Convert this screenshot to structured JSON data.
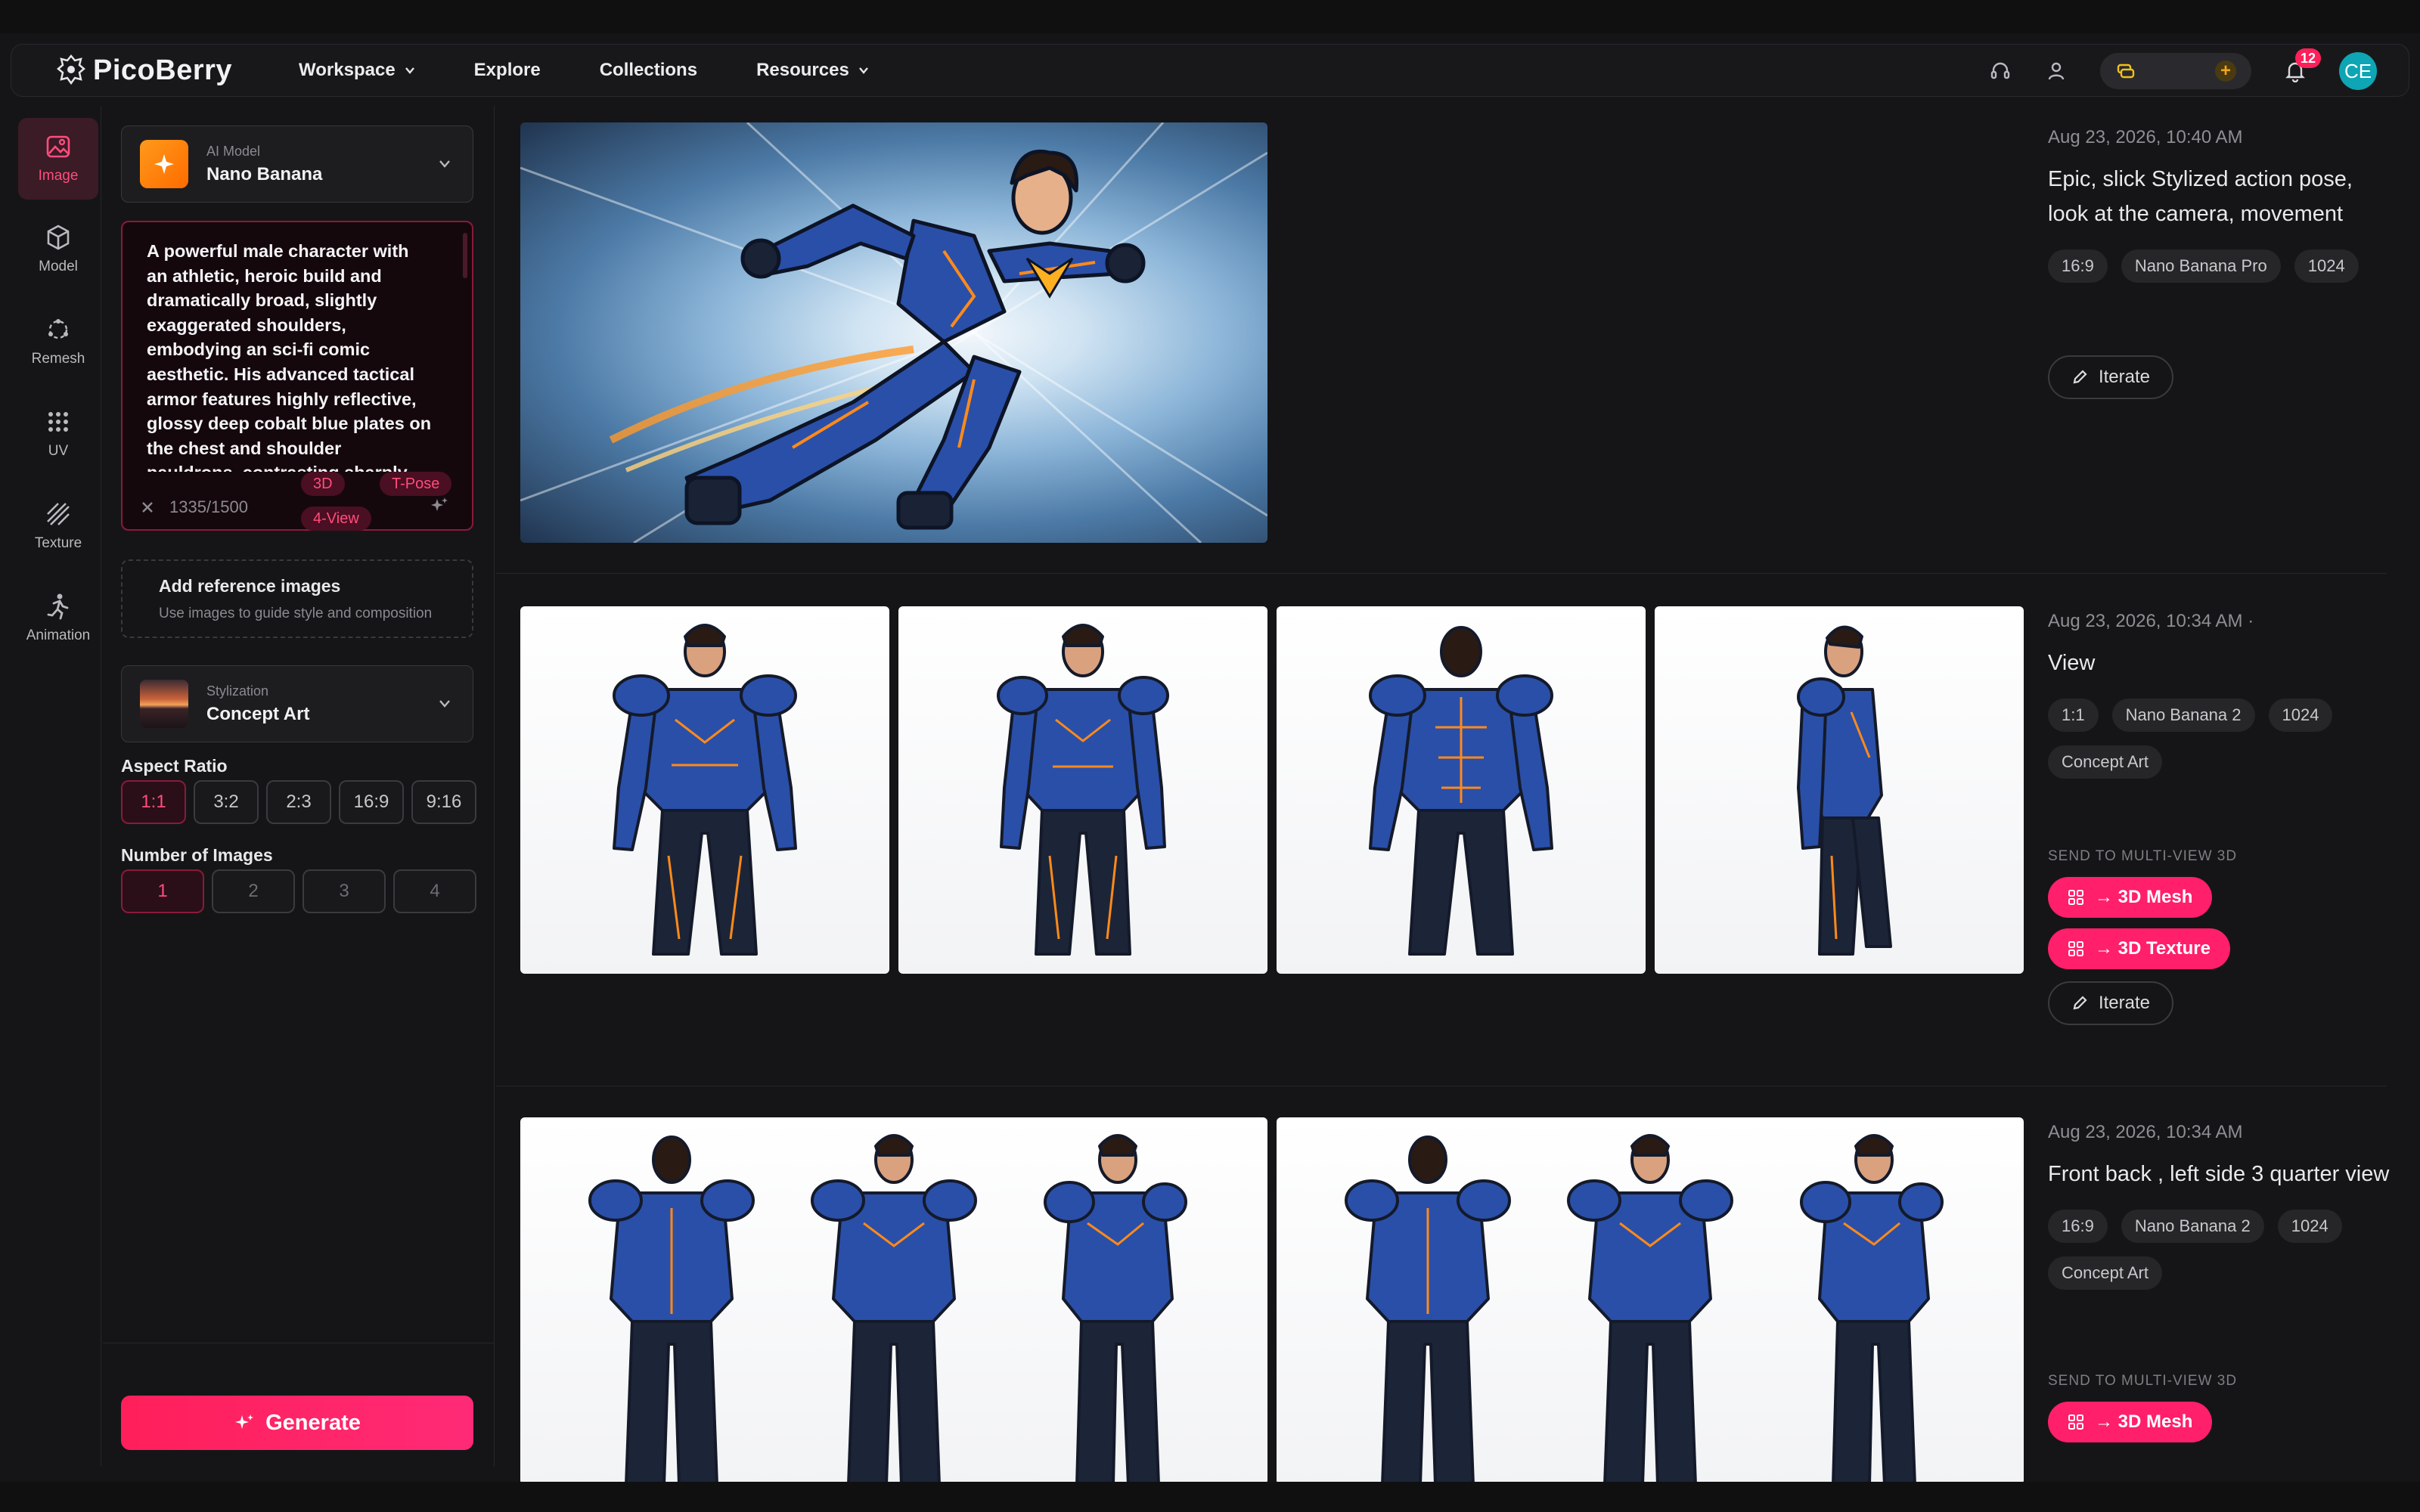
{
  "nav": {
    "logo": "PicoBerry",
    "links": [
      {
        "label": "Workspace",
        "dropdown": true
      },
      {
        "label": "Explore",
        "dropdown": false
      },
      {
        "label": "Collections",
        "dropdown": false
      },
      {
        "label": "Resources",
        "dropdown": true
      }
    ],
    "notifications_count": "12",
    "avatar_initials": "CE"
  },
  "rail": [
    {
      "label": "Image",
      "icon": "image-icon",
      "active": true
    },
    {
      "label": "Model",
      "icon": "cube-icon",
      "active": false
    },
    {
      "label": "Remesh",
      "icon": "remesh-icon",
      "active": false
    },
    {
      "label": "UV",
      "icon": "grid-dots-icon",
      "active": false
    },
    {
      "label": "Texture",
      "icon": "hatch-icon",
      "active": false
    },
    {
      "label": "Animation",
      "icon": "running-icon",
      "active": false
    }
  ],
  "panel": {
    "model_label": "AI Model",
    "model_value": "Nano Banana",
    "prompt_text": "A powerful male character with an athletic, heroic build and dramatically broad, slightly exaggerated shoulders, embodying an sci-fi comic aesthetic. His advanced tactical armor features highly reflective, glossy deep cobalt blue plates on the chest and shoulder pauldrons, contrasting sharply with textured",
    "char_count": "1335/1500",
    "tags": [
      "3D",
      "T-Pose",
      "4-View"
    ],
    "ref_title": "Add reference images",
    "ref_sub": "Use images to guide style and composition",
    "style_label": "Stylization",
    "style_value": "Concept Art",
    "aspect_label": "Aspect Ratio",
    "aspect_options": [
      "1:1",
      "3:2",
      "2:3",
      "16:9",
      "9:16"
    ],
    "aspect_selected": "1:1",
    "count_label": "Number of Images",
    "count_options": [
      "1",
      "2",
      "3",
      "4"
    ],
    "count_selected": "1",
    "generate_label": "Generate"
  },
  "feed": [
    {
      "date": "Aug 23, 2026, 10:40 AM",
      "title": "Epic, slick Stylized action pose, look at the camera, movement",
      "chips": [
        "16:9",
        "Nano Banana Pro",
        "1024"
      ],
      "iterate": "Iterate"
    },
    {
      "date": "Aug 23, 2026, 10:34 AM ·",
      "title": "View",
      "chips": [
        "1:1",
        "Nano Banana 2",
        "1024",
        "Concept Art"
      ],
      "send_label": "SEND TO MULTI-VIEW 3D",
      "actions": [
        "→ 3D Mesh",
        "→ 3D Texture"
      ],
      "iterate": "Iterate"
    },
    {
      "date": "Aug 23, 2026, 10:34 AM",
      "title": "Front back , left side 3 quarter view",
      "chips": [
        "16:9",
        "Nano Banana 2",
        "1024",
        "Concept Art"
      ],
      "send_label": "SEND TO MULTI-VIEW 3D",
      "actions": [
        "→ 3D Mesh"
      ]
    }
  ],
  "colors": {
    "accent": "#ff1f5a",
    "background": "#151517",
    "armor_blue": "#2a4fa8",
    "armor_orange": "#ff8a1a"
  }
}
